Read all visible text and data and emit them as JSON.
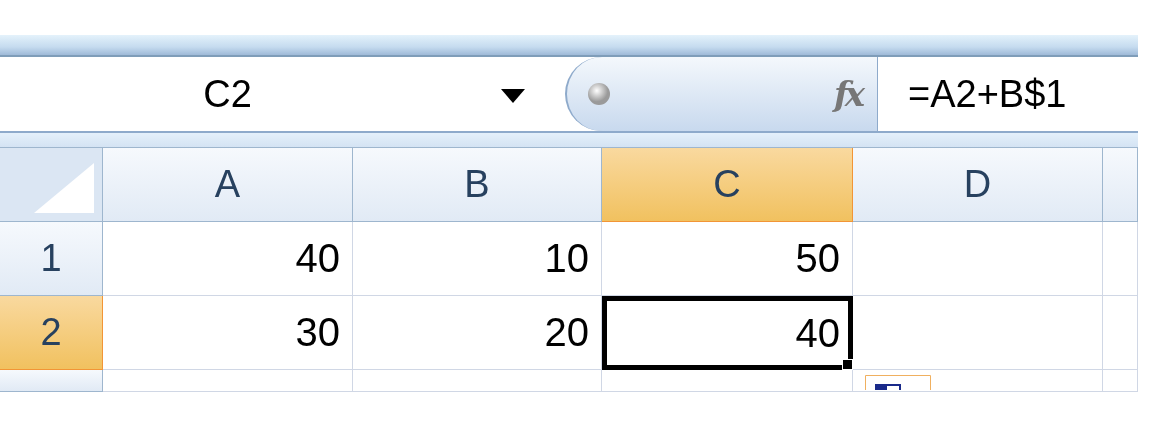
{
  "name_box": {
    "value": "C2"
  },
  "insert_function": {
    "label": "fx"
  },
  "formula_bar": {
    "value": "=A2+B$1"
  },
  "columns": [
    {
      "label": "A",
      "selected": false
    },
    {
      "label": "B",
      "selected": false
    },
    {
      "label": "C",
      "selected": true
    },
    {
      "label": "D",
      "selected": false
    }
  ],
  "rows": [
    {
      "label": "1",
      "selected": false,
      "cells": [
        {
          "value": "40",
          "selected": false
        },
        {
          "value": "10",
          "selected": false
        },
        {
          "value": "50",
          "selected": false
        }
      ]
    },
    {
      "label": "2",
      "selected": true,
      "cells": [
        {
          "value": "30",
          "selected": false
        },
        {
          "value": "20",
          "selected": false
        },
        {
          "value": "40",
          "selected": true
        }
      ]
    }
  ]
}
